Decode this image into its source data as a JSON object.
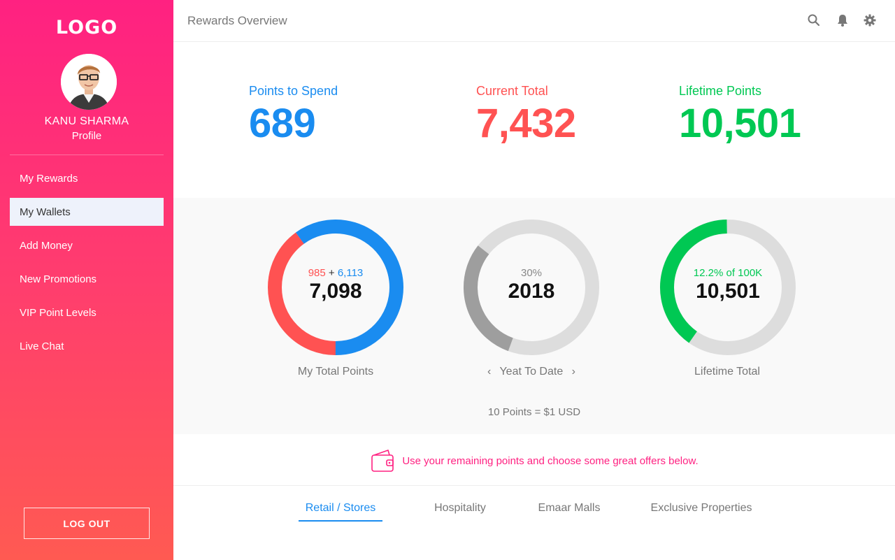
{
  "sidebar": {
    "logo": "LOGO",
    "user_name": "KANU SHARMA",
    "profile_label": "Profile",
    "menu": [
      {
        "label": "My Rewards"
      },
      {
        "label": "My Wallets",
        "active": true
      },
      {
        "label": "Add Money"
      },
      {
        "label": "New Promotions"
      },
      {
        "label": "VIP Point Levels"
      },
      {
        "label": "Live Chat"
      }
    ],
    "logout_label": "LOG OUT"
  },
  "header": {
    "title": "Rewards Overview",
    "icons": [
      "search-icon",
      "bell-icon",
      "gear-icon"
    ]
  },
  "stats": {
    "spend": {
      "label": "Points to Spend",
      "value": "689",
      "color": "#1a8cf0"
    },
    "current": {
      "label": "Current Total",
      "value": "7,432",
      "color": "#ff5252"
    },
    "lifetime": {
      "label": "Lifetime Points",
      "value": "10,501",
      "color": "#00c853"
    }
  },
  "charts": {
    "total": {
      "top_a": "985",
      "top_plus": "+",
      "top_b": "6,113",
      "value": "7,098",
      "caption": "My Total Points",
      "segments": [
        {
          "fraction": 0.4,
          "color": "#ff5252"
        },
        {
          "fraction": 0.6,
          "color": "#1a8cf0"
        }
      ]
    },
    "ytd": {
      "top": "30%",
      "value": "2018",
      "caption": "Yeat To Date",
      "prev_icon": "chevron-left-icon",
      "next_icon": "chevron-right-icon",
      "prev_glyph": "‹",
      "next_glyph": "›",
      "fraction": 0.3,
      "color": "#9e9e9e",
      "track": "#dddddd"
    },
    "lifetime": {
      "top": "12.2% of 100K",
      "value": "10,501",
      "caption": "Lifetime Total",
      "fraction": 0.4,
      "color": "#00c853",
      "track": "#dddddd"
    },
    "rate_note": "10 Points = $1 USD"
  },
  "promo": {
    "icon": "wallet-icon",
    "text": "Use your remaining points and choose some great offers below.",
    "color": "#ff2181"
  },
  "tabs": [
    {
      "label": "Retail / Stores",
      "active": true
    },
    {
      "label": "Hospitality"
    },
    {
      "label": "Emaar Malls"
    },
    {
      "label": "Exclusive Properties"
    }
  ]
}
